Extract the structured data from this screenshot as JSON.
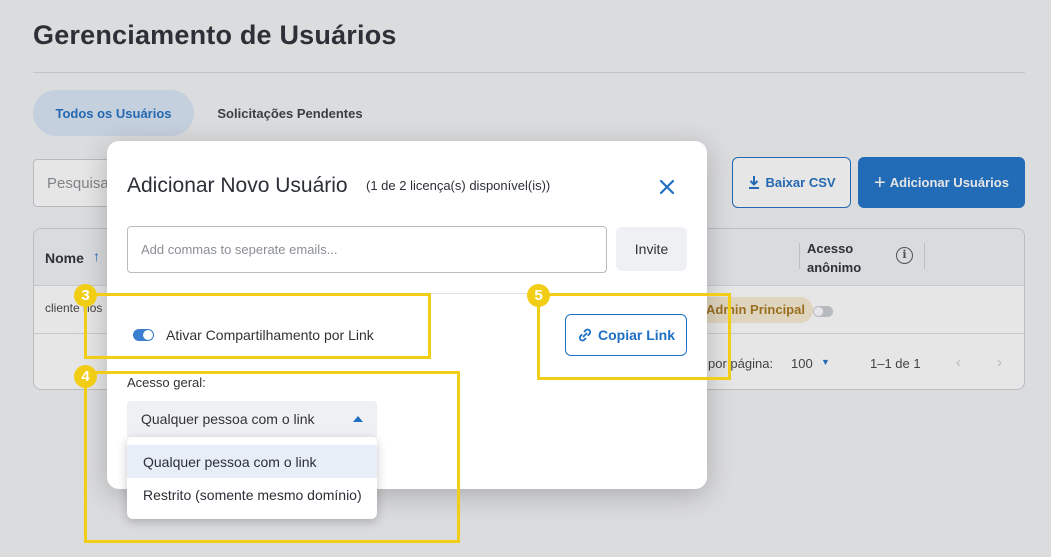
{
  "page": {
    "title": "Gerenciamento de Usuários",
    "tabs": [
      {
        "label": "Todos os Usuários",
        "active": true
      },
      {
        "label": "Solicitações Pendentes",
        "active": false
      }
    ],
    "search_placeholder": "Pesquisar",
    "download_csv_label": "Baixar CSV",
    "add_users_label": "Adicionar Usuários",
    "table": {
      "headers": {
        "name": "Nome",
        "anonymous_access": "Acesso anônimo"
      },
      "rows": [
        {
          "client": "cliente nos",
          "role": "Admin Principal",
          "anonymous": false
        }
      ],
      "pagination": {
        "rows_per_page_label": "por página:",
        "rows_per_page_value": "100",
        "range": "1–1 de 1"
      }
    }
  },
  "modal": {
    "title": "Adicionar Novo Usuário",
    "subtitle": "(1 de 2 licença(s) disponível(is))",
    "email_placeholder": "Add commas to seperate emails...",
    "invite_label": "Invite",
    "share_toggle_label": "Ativar Compartilhamento por Link",
    "share_enabled": true,
    "copy_link_label": "Copiar Link",
    "access_label": "Acesso geral:",
    "access_selected": "Qualquer pessoa com o link",
    "access_options": [
      "Qualquer pessoa com o link",
      "Restrito (somente mesmo domínio)"
    ]
  },
  "annotations": [
    {
      "number": "3"
    },
    {
      "number": "4"
    },
    {
      "number": "5"
    }
  ],
  "colors": {
    "accent": "#1d72c9",
    "annotation": "#f2cd16",
    "badge_bg": "#f7ecd2"
  }
}
